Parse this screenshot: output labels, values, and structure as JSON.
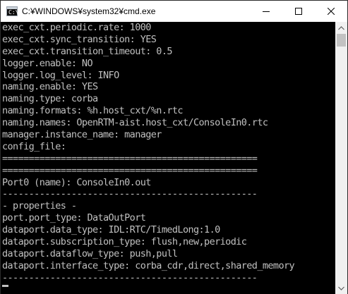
{
  "window": {
    "title": "C:¥WINDOWS¥system32¥cmd.exe",
    "icon_label": "C:\\",
    "controls": {
      "minimize": "minimize-icon",
      "maximize": "maximize-icon",
      "close": "close-icon"
    }
  },
  "console": {
    "lines": [
      "exec_cxt.periodic.rate: 1000",
      "exec_cxt.sync_transition: YES",
      "exec_cxt.transition_timeout: 0.5",
      "logger.enable: NO",
      "logger.log_level: INFO",
      "naming.enable: YES",
      "naming.type: corba",
      "naming.formats: %h.host_cxt/%n.rtc",
      "naming.names: OpenRTM-aist.host_cxt/ConsoleIn0.rtc",
      "manager.instance_name: manager",
      "config_file:",
      "================================================",
      "================================================",
      "Port0 (name): ConsoleIn0.out",
      "------------------------------------------------",
      "- properties -",
      "port.port_type: DataOutPort",
      "dataport.data_type: IDL:RTC/TimedLong:1.0",
      "dataport.subscription_type: flush,new,periodic",
      "dataport.dataflow_type: push,pull",
      "dataport.interface_type: corba_cdr,direct,shared_memory",
      "------------------------------------------------"
    ],
    "text_color": "#c0c0c0",
    "background": "#000000"
  },
  "scrollbar": {
    "up": "scroll-up-arrow-icon",
    "down": "scroll-down-arrow-icon"
  }
}
